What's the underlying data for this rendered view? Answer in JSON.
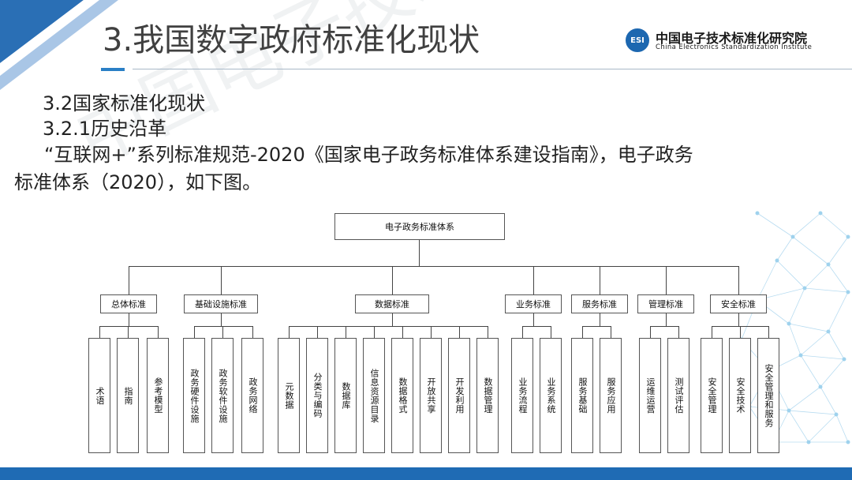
{
  "header": {
    "title": "3.我国数字政府标准化现状",
    "logo": {
      "badge": "ESI",
      "name_cn": "中国电子技术标准化研究院",
      "name_en": "China Electronics Standardization Institute"
    }
  },
  "body": {
    "line1": "3.2国家标准化现状",
    "line2": "3.2.1历史沿革",
    "line3": "“互联网+”系列标准规范-2020《国家电子政务标准体系建设指南》，电子政务",
    "line4": "标准体系（2020），如下图。"
  },
  "watermark": "中国电子技术标准化研究院",
  "diagram": {
    "root": "电子政务标准体系",
    "categories": [
      {
        "label": "总体标准",
        "children": [
          "术语",
          "指南",
          "参考模型"
        ]
      },
      {
        "label": "基础设施标准",
        "children": [
          "政务硬件设施",
          "政务软件设施",
          "政务网络"
        ]
      },
      {
        "label": "数据标准",
        "children": [
          "元数据",
          "分类与编码",
          "数据库",
          "信息资源目录",
          "数据格式",
          "开放共享",
          "开发利用",
          "数据管理"
        ]
      },
      {
        "label": "业务标准",
        "children": [
          "业务流程",
          "业务系统"
        ]
      },
      {
        "label": "服务标准",
        "children": [
          "服务基础",
          "服务应用"
        ]
      },
      {
        "label": "管理标准",
        "children": [
          "运维运营",
          "测试评估"
        ]
      },
      {
        "label": "安全标准",
        "children": [
          "安全管理",
          "安全技术",
          "安全管理和服务"
        ]
      }
    ]
  },
  "colors": {
    "accent": "#1f6bb4",
    "deco_dark": "#2a6fb5",
    "deco_light": "#a9c6e6",
    "network": "#7fc4e8"
  }
}
